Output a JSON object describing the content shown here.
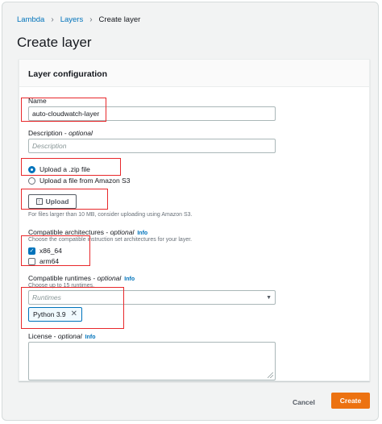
{
  "breadcrumb": {
    "items": [
      "Lambda",
      "Layers"
    ],
    "current": "Create layer"
  },
  "page": {
    "title": "Create layer"
  },
  "panel": {
    "title": "Layer configuration"
  },
  "name_field": {
    "label": "Name",
    "value": "auto-cloudwatch-layer"
  },
  "description_field": {
    "label": "Description",
    "optional": "optional",
    "placeholder": "Description"
  },
  "upload_options": {
    "zip_label": "Upload a .zip file",
    "s3_label": "Upload a file from Amazon S3",
    "selected": "zip"
  },
  "upload_button": {
    "label": "Upload",
    "hint": "For files larger than 10 MB, consider uploading using Amazon S3."
  },
  "architectures": {
    "label": "Compatible architectures",
    "optional": "optional",
    "info": "Info",
    "hint": "Choose the compatible instruction set architectures for your layer.",
    "options": [
      {
        "label": "x86_64",
        "checked": true
      },
      {
        "label": "arm64",
        "checked": false
      }
    ]
  },
  "runtimes": {
    "label": "Compatible runtimes",
    "optional": "optional",
    "info": "Info",
    "hint": "Choose up to 15 runtimes.",
    "placeholder": "Runtimes",
    "selected": [
      "Python 3.9"
    ]
  },
  "license": {
    "label": "License",
    "optional": "optional",
    "info": "Info"
  },
  "footer": {
    "cancel_label": "Cancel",
    "create_label": "Create"
  },
  "colors": {
    "accent": "#0073bb",
    "primary_button": "#ec7211",
    "highlight": "#e8282b"
  }
}
